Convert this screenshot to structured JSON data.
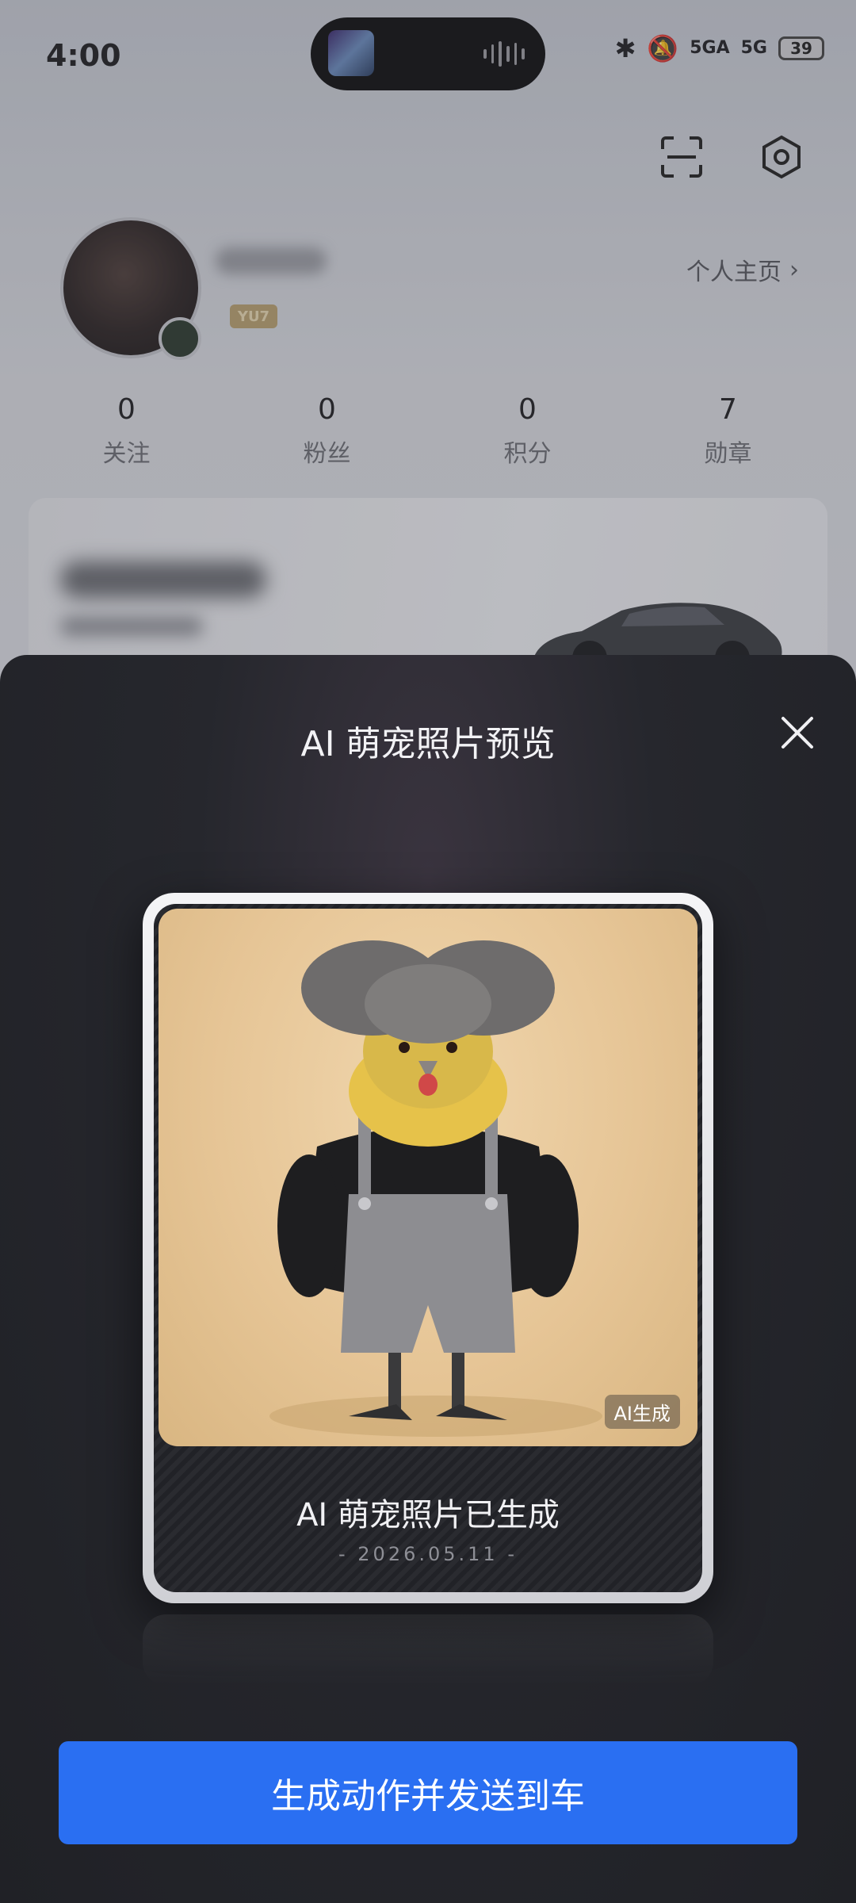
{
  "status_bar": {
    "time": "4:00",
    "network_1": "5GA",
    "network_2": "5G",
    "battery": "39"
  },
  "profile": {
    "badge": "YU7",
    "homepage_link": "个人主页",
    "stats": [
      {
        "value": "0",
        "label": "关注"
      },
      {
        "value": "0",
        "label": "粉丝"
      },
      {
        "value": "0",
        "label": "积分"
      },
      {
        "value": "7",
        "label": "勋章"
      }
    ]
  },
  "sheet": {
    "title": "AI 萌宠照片预览",
    "ai_tag": "AI生成",
    "generated_title": "AI 萌宠照片已生成",
    "generated_date": "- 2026.05.11 -",
    "action_button": "生成动作并发送到车"
  },
  "colors": {
    "accent": "#2a6ff2",
    "sheet_bg": "#222329"
  }
}
